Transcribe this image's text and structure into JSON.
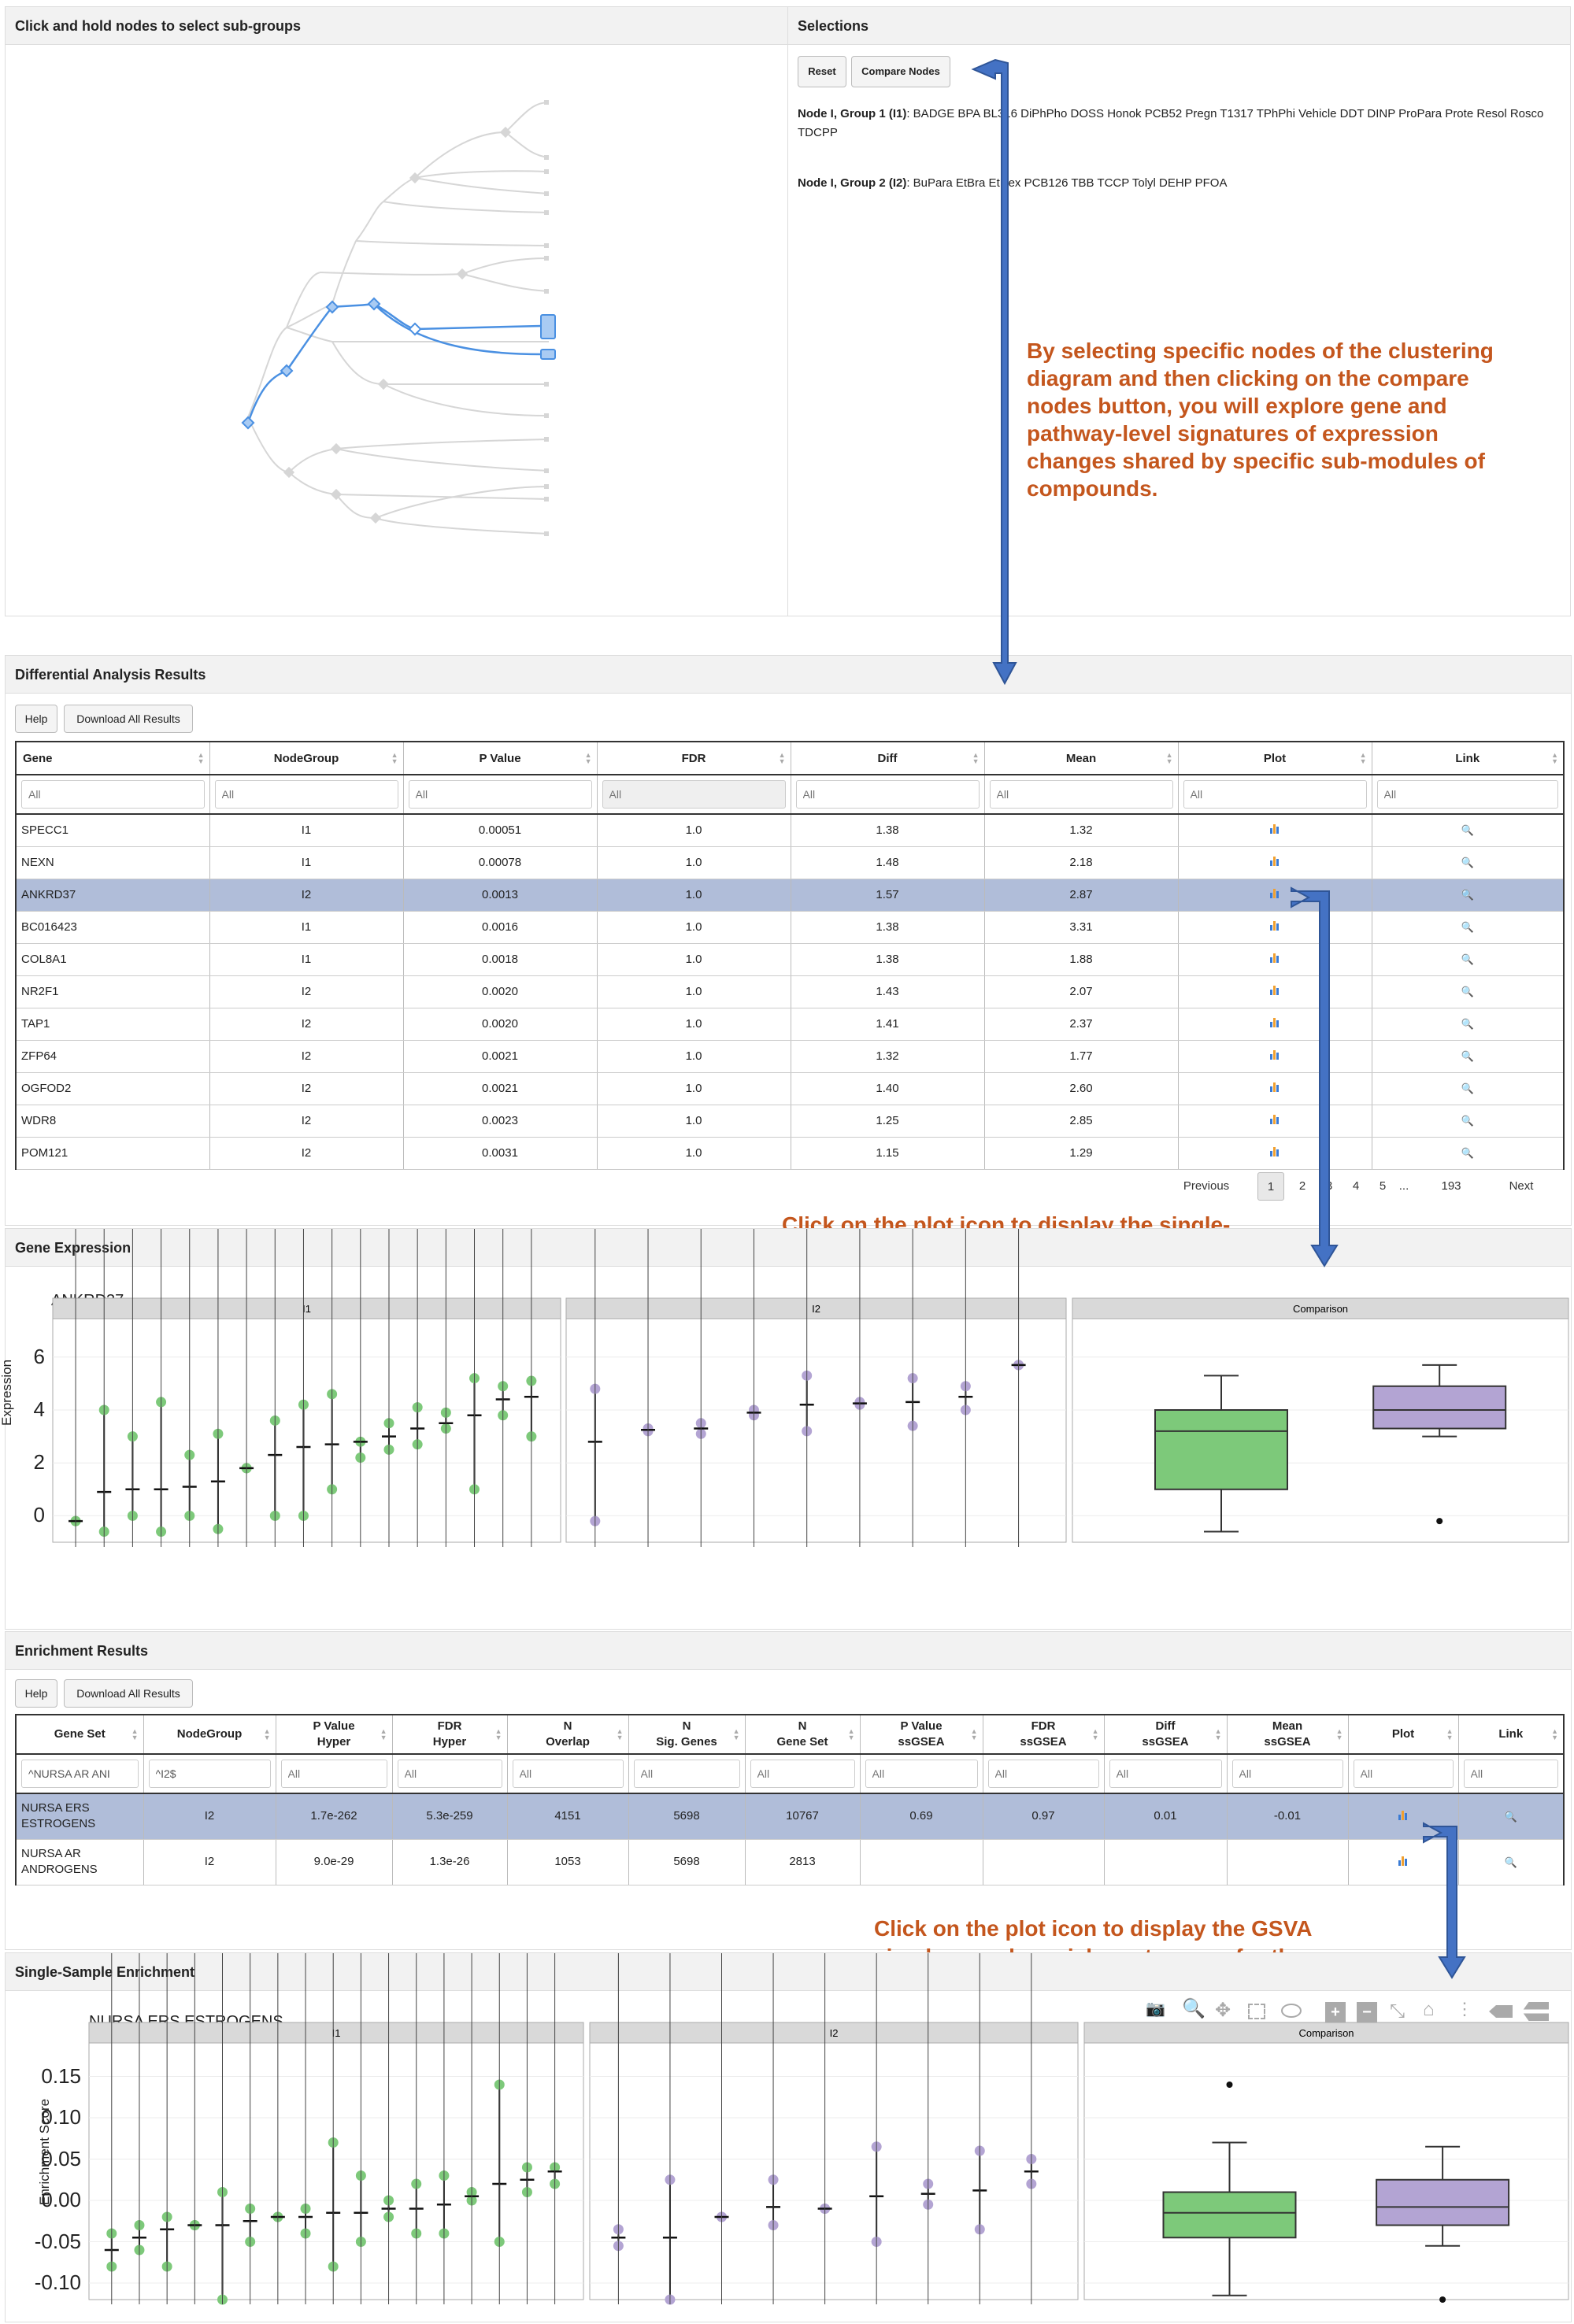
{
  "tree_panel": {
    "title": "Click and hold nodes to select sub-groups"
  },
  "selections": {
    "title": "Selections",
    "reset_label": "Reset",
    "compare_label": "Compare Nodes",
    "group1_label": "Node I, Group 1 (I1)",
    "group1_list": ": BADGE  BPA  BL316  DiPhPho  DOSS  Honok  PCB52  Pregn  T1317  TPhPhi  Vehicle  DDT  DINP  ProPara  Prote  Resol  Rosco  TDCPP",
    "group2_label": "Node I, Group 2 (I2)",
    "group2_list": ": BuPara  EtBra  EtHex  PCB126  TBB  TCCP  Tolyl  DEHP  PFOA"
  },
  "annotations": {
    "a1": "By selecting specific nodes of the clustering diagram and then clicking on the compare nodes button, you will explore gene and pathway-level signatures of expression changes shared by specific sub-modules of compounds.",
    "a2": "Click on the plot icon to display the single-sample gene expression scores for the chemicals in the split",
    "a3": "Click on the plot icon to display the GSVA simple-sample enrichment scores for the chemicals in the split"
  },
  "diff": {
    "title": "Differential Analysis Results",
    "help_label": "Help",
    "download_label": "Download All Results",
    "columns": [
      "Gene",
      "NodeGroup",
      "P Value",
      "FDR",
      "Diff",
      "Mean",
      "Plot",
      "Link"
    ],
    "filter_placeholder": "All",
    "rows": [
      [
        "SPECC1",
        "I1",
        "0.00051",
        "1.0",
        "1.38",
        "1.32"
      ],
      [
        "NEXN",
        "I1",
        "0.00078",
        "1.0",
        "1.48",
        "2.18"
      ],
      [
        "ANKRD37",
        "I2",
        "0.0013",
        "1.0",
        "1.57",
        "2.87"
      ],
      [
        "BC016423",
        "I1",
        "0.0016",
        "1.0",
        "1.38",
        "3.31"
      ],
      [
        "COL8A1",
        "I1",
        "0.0018",
        "1.0",
        "1.38",
        "1.88"
      ],
      [
        "NR2F1",
        "I2",
        "0.0020",
        "1.0",
        "1.43",
        "2.07"
      ],
      [
        "TAP1",
        "I2",
        "0.0020",
        "1.0",
        "1.41",
        "2.37"
      ],
      [
        "ZFP64",
        "I2",
        "0.0021",
        "1.0",
        "1.32",
        "1.77"
      ],
      [
        "OGFOD2",
        "I2",
        "0.0021",
        "1.0",
        "1.40",
        "2.60"
      ],
      [
        "WDR8",
        "I2",
        "0.0023",
        "1.0",
        "1.25",
        "2.85"
      ],
      [
        "POM121",
        "I2",
        "0.0031",
        "1.0",
        "1.15",
        "1.29"
      ]
    ],
    "selected_row": 2,
    "pagination": [
      "Previous",
      "1",
      "2",
      "3",
      "4",
      "5",
      "...",
      "193",
      "Next"
    ]
  },
  "gene_expr": {
    "title": "Gene Expression",
    "plot_title": "ANKRD37",
    "ylabel": "Expression",
    "facets": [
      "I1",
      "I2",
      "Comparison"
    ],
    "yticks": [
      "6",
      "4",
      "2",
      "0"
    ]
  },
  "enrich": {
    "title": "Enrichment Results",
    "help_label": "Help",
    "download_label": "Download All Results",
    "columns": [
      "Gene Set",
      "NodeGroup",
      "P Value\nHyper",
      "FDR\nHyper",
      "N\nOverlap",
      "N\nSig. Genes",
      "N\nGene Set",
      "P Value\nssGSEA",
      "FDR\nssGSEA",
      "Diff\nssGSEA",
      "Mean\nssGSEA",
      "Plot",
      "Link"
    ],
    "filters": [
      "^NURSA AR ANI",
      "^I2$",
      "All",
      "All",
      "All",
      "All",
      "All",
      "All",
      "All",
      "All",
      "All",
      "All",
      "All"
    ],
    "rows": [
      [
        "NURSA ERS\nESTROGENS",
        "I2",
        "1.7e-262",
        "5.3e-259",
        "4151",
        "5698",
        "10767",
        "0.69",
        "0.97",
        "0.01",
        "-0.01"
      ],
      [
        "NURSA AR\nANDROGENS",
        "I2",
        "9.0e-29",
        "1.3e-26",
        "1053",
        "5698",
        "2813",
        "",
        "",
        "",
        ""
      ]
    ],
    "selected_row": 0
  },
  "ss_enrich": {
    "title": "Single-Sample Enrichment",
    "plot_title": "NURSA ERS ESTROGENS",
    "ylabel": "Enrichment Score",
    "facets": [
      "I1",
      "I2",
      "Comparison"
    ],
    "yticks": [
      "0.15",
      "0.10",
      "0.05",
      "0.00",
      "-0.05",
      "-0.10"
    ]
  },
  "colors": {
    "group1": "#7dc97a",
    "group2": "#b3a4d3",
    "annotation": "#c4561d",
    "arrow": "#4472c4",
    "selected_row": "#b0bdd9"
  },
  "chart_data": [
    {
      "type": "scatter",
      "title": "ANKRD37",
      "ylabel": "Expression",
      "ylim": [
        -1,
        6.5
      ],
      "series": [
        {
          "name": "I1",
          "samples": [
            [
              -0.2,
              -0.2
            ],
            [
              4,
              -0.6
            ],
            [
              3,
              0
            ],
            [
              4.3,
              -0.6
            ],
            [
              2.3,
              0
            ],
            [
              3.1,
              -0.5
            ],
            [
              1.8,
              1.8
            ],
            [
              3.6,
              0
            ],
            [
              4.2,
              0
            ],
            [
              4.6,
              1
            ],
            [
              2.8,
              2.2
            ],
            [
              3.5,
              2.5
            ],
            [
              4.1,
              2.7
            ],
            [
              3.9,
              3.3
            ],
            [
              5.2,
              1
            ],
            [
              4.9,
              3.8
            ],
            [
              5.1,
              3
            ]
          ],
          "means": [
            -0.2,
            0.9,
            1.0,
            1.0,
            1.1,
            1.3,
            1.8,
            2.3,
            2.6,
            2.7,
            2.8,
            3.0,
            3.3,
            3.5,
            3.8,
            4.4,
            4.5
          ]
        },
        {
          "name": "I2",
          "samples": [
            [
              4.8,
              -0.2
            ],
            [
              3.3,
              3.2
            ],
            [
              3.5,
              3.1
            ],
            [
              4,
              3.8
            ],
            [
              5.3,
              3.2
            ],
            [
              4.3,
              4.2
            ],
            [
              5.2,
              3.4
            ],
            [
              4.9,
              4
            ],
            [
              5.7,
              5.7
            ]
          ],
          "means": [
            2.8,
            3.25,
            3.3,
            3.9,
            4.2,
            4.25,
            4.3,
            4.5,
            5.7
          ]
        },
        {
          "name": "Comparison",
          "boxes": [
            {
              "min": -0.6,
              "q1": 1.0,
              "median": 3.2,
              "q3": 4.0,
              "max": 5.3,
              "outliers": []
            },
            {
              "min": 3.0,
              "q1": 3.3,
              "median": 4.0,
              "q3": 4.9,
              "max": 5.7,
              "outliers": [
                -0.2
              ]
            }
          ]
        }
      ]
    },
    {
      "type": "scatter",
      "title": "NURSA ERS ESTROGENS",
      "ylabel": "Enrichment Score",
      "ylim": [
        -0.12,
        0.16
      ],
      "series": [
        {
          "name": "I1",
          "samples": [
            [
              -0.04,
              -0.08
            ],
            [
              -0.03,
              -0.06
            ],
            [
              -0.02,
              -0.08
            ],
            [
              -0.03,
              -0.03
            ],
            [
              0.01,
              -0.12
            ],
            [
              -0.01,
              -0.05
            ],
            [
              -0.02,
              -0.02
            ],
            [
              -0.01,
              -0.04
            ],
            [
              0.07,
              -0.08
            ],
            [
              0.03,
              -0.05
            ],
            [
              0.0,
              -0.02
            ],
            [
              0.02,
              -0.04
            ],
            [
              0.03,
              -0.04
            ],
            [
              0.01,
              0.0
            ],
            [
              0.14,
              -0.05
            ],
            [
              0.04,
              0.01
            ],
            [
              0.04,
              0.02
            ]
          ],
          "means": [
            -0.06,
            -0.045,
            -0.035,
            -0.03,
            -0.03,
            -0.025,
            -0.02,
            -0.02,
            -0.015,
            -0.015,
            -0.01,
            -0.01,
            -0.005,
            0.005,
            0.02,
            0.025,
            0.035
          ]
        },
        {
          "name": "I2",
          "samples": [
            [
              -0.035,
              -0.055
            ],
            [
              0.025,
              -0.12
            ],
            [
              -0.02,
              -0.02
            ],
            [
              0.025,
              -0.03
            ],
            [
              -0.01,
              -0.01
            ],
            [
              0.065,
              -0.05
            ],
            [
              0.02,
              -0.005
            ],
            [
              0.06,
              -0.035
            ],
            [
              0.05,
              0.02
            ]
          ],
          "means": [
            -0.045,
            -0.045,
            -0.02,
            -0.008,
            -0.01,
            0.005,
            0.008,
            0.012,
            0.035
          ]
        },
        {
          "name": "Comparison",
          "boxes": [
            {
              "min": -0.115,
              "q1": -0.045,
              "median": -0.015,
              "q3": 0.01,
              "max": 0.07,
              "outliers": [
                0.14
              ]
            },
            {
              "min": -0.055,
              "q1": -0.03,
              "median": -0.008,
              "q3": 0.025,
              "max": 0.065,
              "outliers": [
                -0.12
              ]
            }
          ]
        }
      ]
    }
  ]
}
